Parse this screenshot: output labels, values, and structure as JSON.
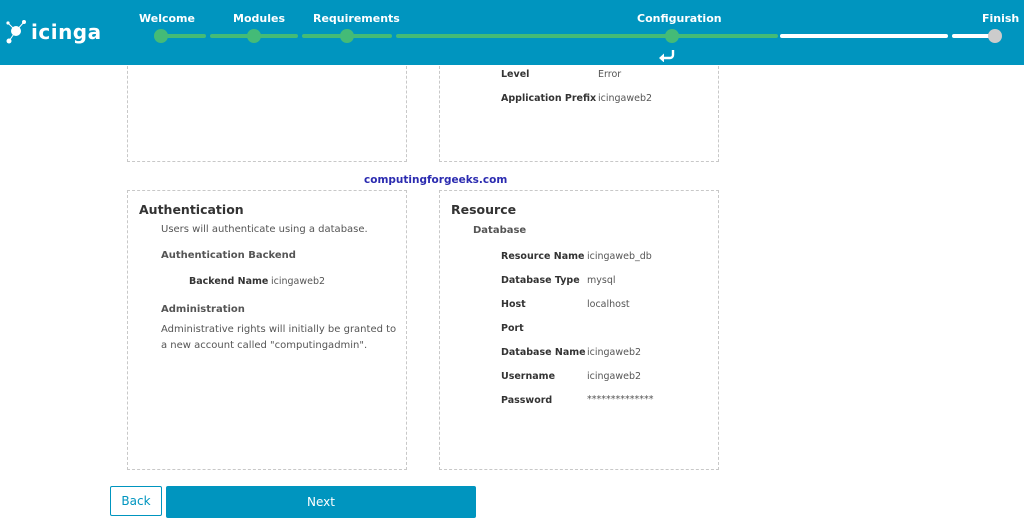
{
  "brand": {
    "logo_text": "icinga"
  },
  "wizard": {
    "steps": [
      {
        "label": "Welcome",
        "state": "done"
      },
      {
        "label": "Modules",
        "state": "done"
      },
      {
        "label": "Requirements",
        "state": "done"
      },
      {
        "label": "Configuration",
        "state": "active"
      },
      {
        "label": "Finish",
        "state": "todo"
      }
    ]
  },
  "logging_panel": {
    "rows": [
      {
        "label": "Level",
        "value": "Error"
      },
      {
        "label": "Application Prefix",
        "value": "icingaweb2"
      }
    ]
  },
  "watermark": "computingforgeeks.com",
  "authentication": {
    "title": "Authentication",
    "intro": "Users will authenticate using a database.",
    "backend_heading": "Authentication Backend",
    "backend_label": "Backend Name",
    "backend_value": "icingaweb2",
    "admin_heading": "Administration",
    "admin_text": "Administrative rights will initially be granted to a new account called \"computingadmin\"."
  },
  "resource": {
    "title": "Resource",
    "subtitle": "Database",
    "rows": [
      {
        "label": "Resource Name",
        "value": "icingaweb_db"
      },
      {
        "label": "Database Type",
        "value": "mysql"
      },
      {
        "label": "Host",
        "value": "localhost"
      },
      {
        "label": "Port",
        "value": ""
      },
      {
        "label": "Database Name",
        "value": "icingaweb2"
      },
      {
        "label": "Username",
        "value": "icingaweb2"
      },
      {
        "label": "Password",
        "value": "**************"
      }
    ]
  },
  "buttons": {
    "back": "Back",
    "next": "Next"
  },
  "colors": {
    "header": "#0095bf",
    "progress_done": "#44bb77",
    "progress_todo": "#ffffff"
  }
}
